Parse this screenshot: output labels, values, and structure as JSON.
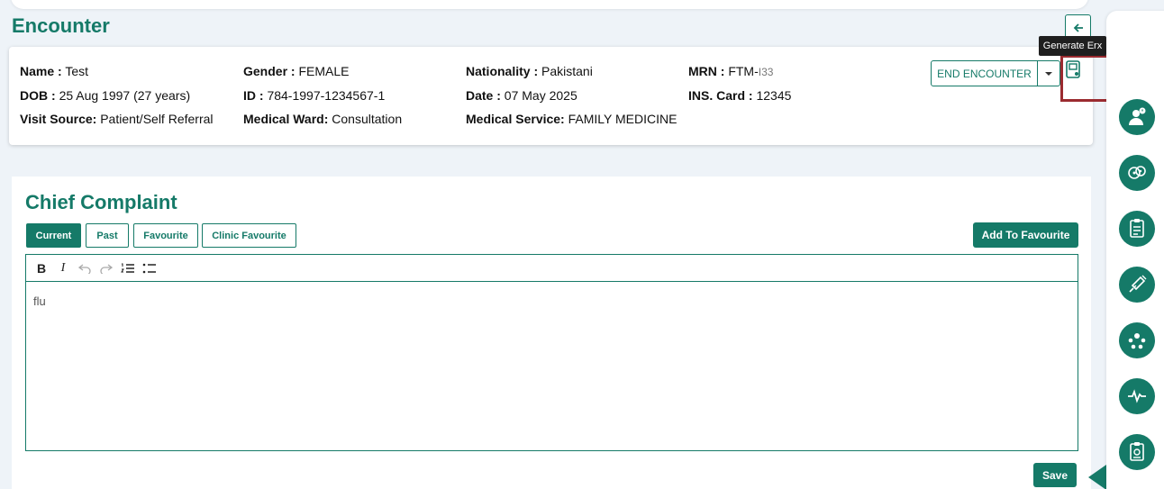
{
  "page": {
    "title": "Encounter"
  },
  "patient": {
    "name_label": "Name :",
    "name": "Test",
    "dob_label": "DOB :",
    "dob": "25 Aug 1997 (27 years)",
    "visit_source_label": "Visit Source:",
    "visit_source": "Patient/Self Referral",
    "gender_label": "Gender :",
    "gender": "FEMALE",
    "id_label": "ID :",
    "id": "784-1997-1234567-1",
    "ward_label": "Medical Ward:",
    "ward": "Consultation",
    "nationality_label": "Nationality :",
    "nationality": "Pakistani",
    "date_label": "Date :",
    "date": "07 May 2025",
    "service_label": "Medical Service:",
    "service": "FAMILY MEDICINE",
    "mrn_label": "MRN :",
    "mrn_prefix": "FTM-",
    "mrn_suffix": "I33",
    "ins_label": "INS. Card :",
    "ins": "12345"
  },
  "actions": {
    "end_encounter": "END ENCOUNTER",
    "tooltip": "Generate Erx"
  },
  "complaint": {
    "title": "Chief Complaint",
    "tabs": [
      "Current",
      "Past",
      "Favourite",
      "Clinic Favourite"
    ],
    "add_favourite": "Add To Favourite",
    "text": "flu",
    "save": "Save"
  },
  "colors": {
    "brand": "#157a68",
    "highlight": "#9b2b30"
  },
  "side_icons": [
    "patient-alert-icon",
    "microbe-icon",
    "clipboard-clock-icon",
    "syringe-icon",
    "team-icon",
    "vitals-icon",
    "report-icon"
  ]
}
